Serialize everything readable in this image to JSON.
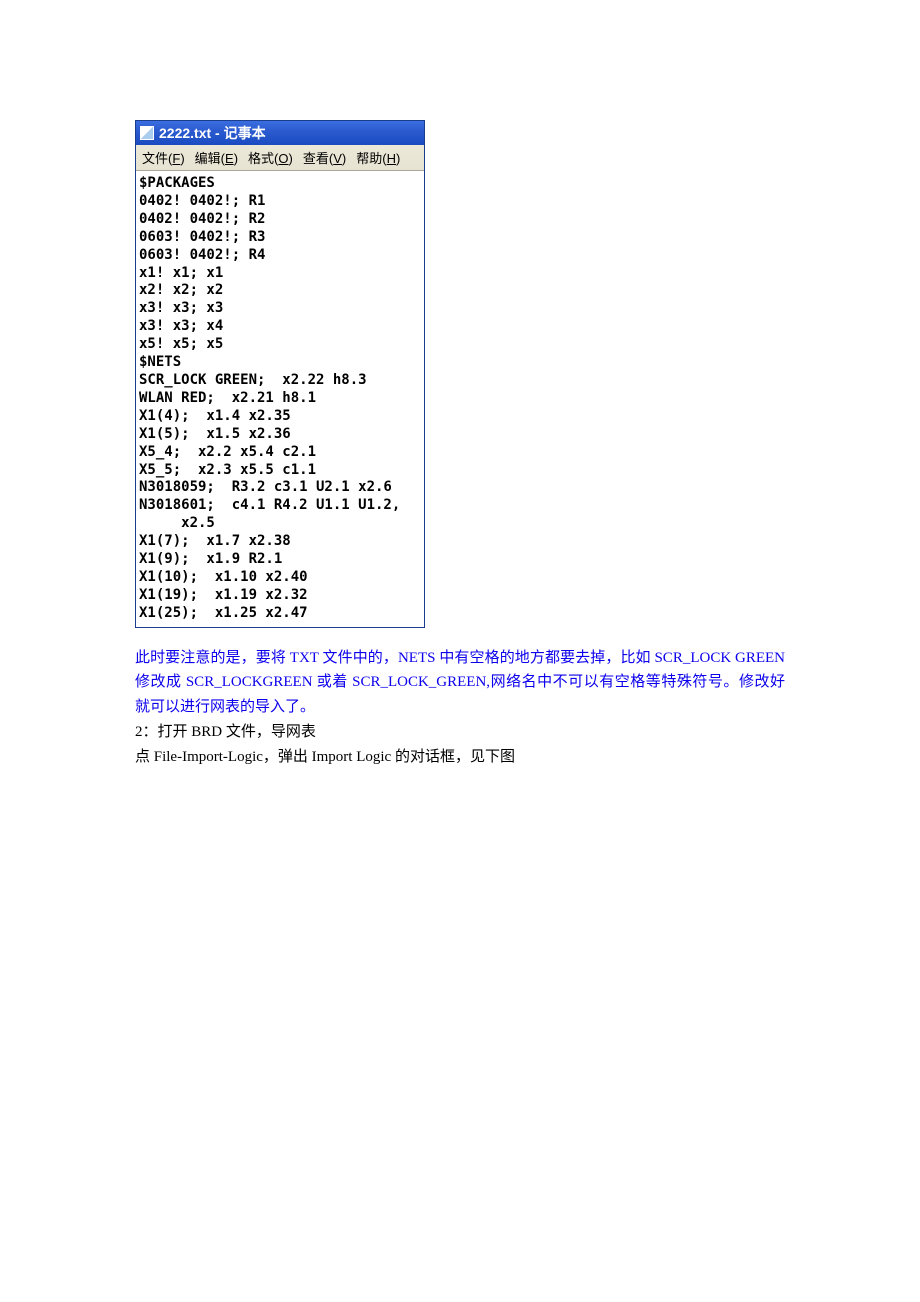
{
  "notepad": {
    "title": "2222.txt - 记事本",
    "menus": [
      {
        "label": "文件",
        "accel": "F"
      },
      {
        "label": "编辑",
        "accel": "E"
      },
      {
        "label": "格式",
        "accel": "O"
      },
      {
        "label": "查看",
        "accel": "V"
      },
      {
        "label": "帮助",
        "accel": "H"
      }
    ],
    "content": "$PACKAGES\n0402! 0402!; R1\n0402! 0402!; R2\n0603! 0402!; R3\n0603! 0402!; R4\nx1! x1; x1\nx2! x2; x2\nx3! x3; x3\nx3! x3; x4\nx5! x5; x5\n$NETS\nSCR_LOCK GREEN;  x2.22 h8.3\nWLAN RED;  x2.21 h8.1\nX1(4);  x1.4 x2.35\nX1(5);  x1.5 x2.36\nX5_4;  x2.2 x5.4 c2.1\nX5_5;  x2.3 x5.5 c1.1\nN3018059;  R3.2 c3.1 U2.1 x2.6\nN3018601;  c4.1 R4.2 U1.1 U1.2,\n     x2.5\nX1(7);  x1.7 x2.38\nX1(9);  x1.9 R2.1\nX1(10);  x1.10 x2.40\nX1(19);  x1.19 x2.32\nX1(25);  x1.25 x2.47"
  },
  "doc": {
    "note_blue": "此时要注意的是，要将 TXT 文件中的，NETS 中有空格的地方都要去掉，比如 SCR_LOCK GREEN 修改成 SCR_LOCKGREEN 或着 SCR_LOCK_GREEN,网络名中不可以有空格等特殊符号。修改好就可以进行网表的导入了。",
    "line2": "2：打开 BRD 文件，导网表",
    "line3": "点 File-Import-Logic，弹出 Import Logic 的对话框，见下图"
  }
}
